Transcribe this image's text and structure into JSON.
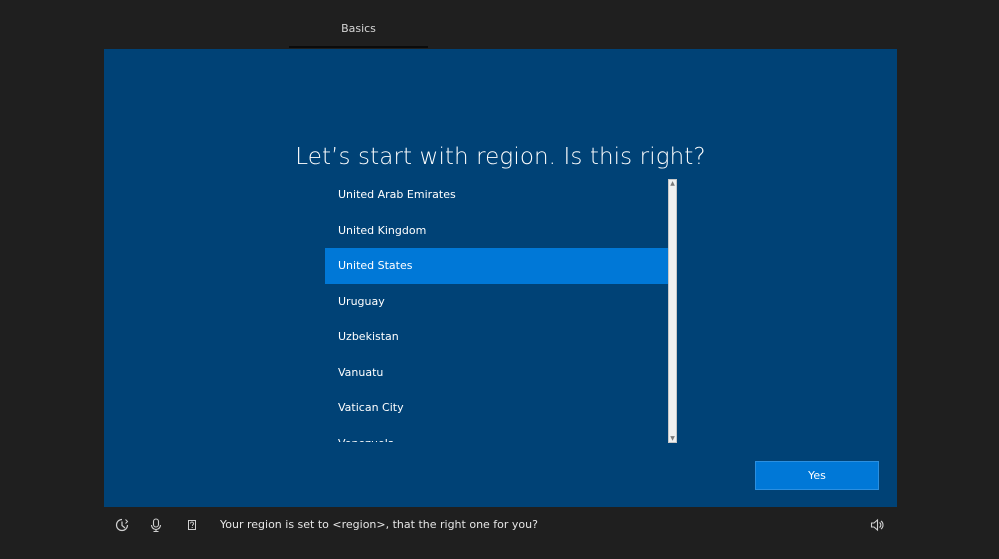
{
  "header": {
    "tab_label": "Basics"
  },
  "main": {
    "title": "Let’s start with region. Is this right?",
    "regions": [
      {
        "label": "United Arab Emirates",
        "selected": false
      },
      {
        "label": "United Kingdom",
        "selected": false
      },
      {
        "label": "United States",
        "selected": true
      },
      {
        "label": "Uruguay",
        "selected": false
      },
      {
        "label": "Uzbekistan",
        "selected": false
      },
      {
        "label": "Vanuatu",
        "selected": false
      },
      {
        "label": "Vatican City",
        "selected": false
      },
      {
        "label": "Venezuela",
        "selected": false
      }
    ],
    "yes_label": "Yes"
  },
  "footer": {
    "narrator_text": "Your region is set to <region>, that the right one for you?",
    "icons": [
      "ease-of-access-icon",
      "microphone-icon",
      "keyboard-icon",
      "volume-icon"
    ]
  },
  "colors": {
    "background": "#1f1f1f",
    "panel": "#004276",
    "accent": "#0078d7"
  }
}
